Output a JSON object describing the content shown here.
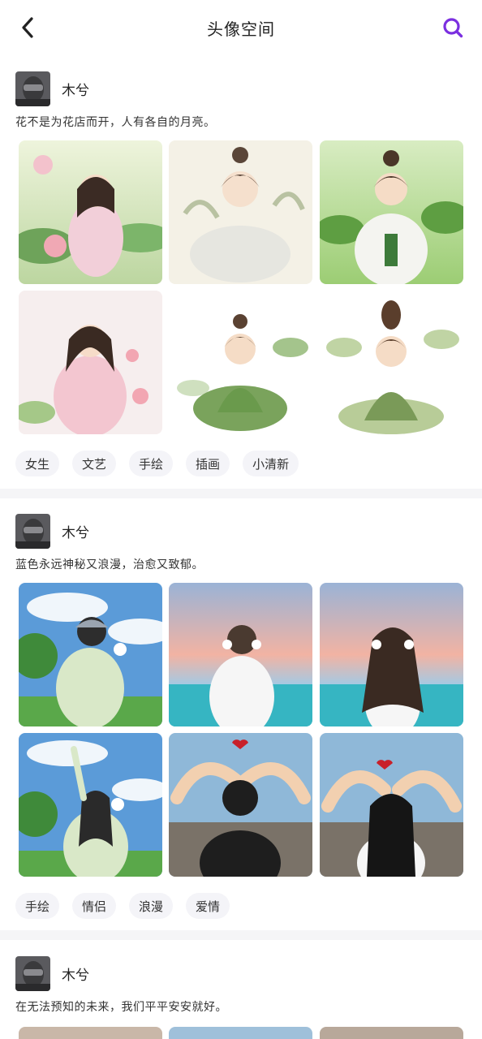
{
  "header": {
    "title": "头像空间",
    "back_icon": "chevron-left-icon",
    "search_icon": "search-icon",
    "accent_color": "#7b2fe0"
  },
  "posts": [
    {
      "author": "木兮",
      "text": "花不是为花店而开，人有各自的月亮。",
      "tags": [
        "女生",
        "文艺",
        "手绘",
        "插画",
        "小清新"
      ]
    },
    {
      "author": "木兮",
      "text": "蓝色永远神秘又浪漫，治愈又致郁。",
      "tags": [
        "手绘",
        "情侣",
        "浪漫",
        "爱情"
      ]
    },
    {
      "author": "木兮",
      "text": "在无法预知的未来，我们平平安安就好。",
      "tags": []
    }
  ]
}
